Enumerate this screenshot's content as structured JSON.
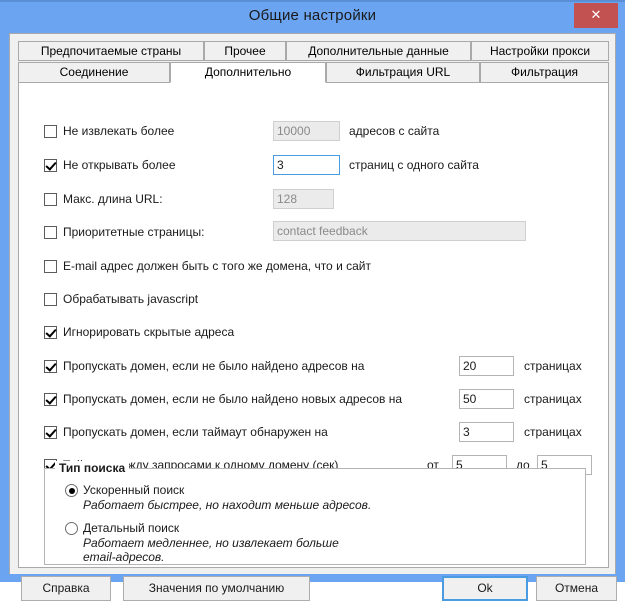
{
  "window": {
    "title": "Общие настройки",
    "close_label": "✕",
    "titlebar_color": "#6ba5f2",
    "close_color": "#c25252"
  },
  "tabs": {
    "row1": [
      {
        "label": "Предпочитаемые страны",
        "active": false
      },
      {
        "label": "Прочее",
        "active": false
      },
      {
        "label": "Дополнительные данные",
        "active": false
      },
      {
        "label": "Настройки прокси",
        "active": false
      }
    ],
    "row2": [
      {
        "label": "Соединение",
        "active": false
      },
      {
        "label": "Дополнительно",
        "active": true
      },
      {
        "label": "Фильтрация URL",
        "active": false
      },
      {
        "label": "Фильтрация",
        "active": false
      }
    ]
  },
  "options": {
    "max_extract": {
      "label": "Не извлекать более",
      "checked": false,
      "value": "10000",
      "suffix": "адресов с сайта",
      "disabled": true
    },
    "max_open": {
      "label": "Не открывать более",
      "checked": true,
      "value": "3",
      "suffix": "страниц с одного сайта",
      "disabled": false,
      "focused": true
    },
    "max_url_len": {
      "label": "Макс. длина URL:",
      "checked": false,
      "value": "128",
      "suffix": "",
      "disabled": true
    },
    "priority_pages": {
      "label": "Приоритетные страницы:",
      "checked": false,
      "value": "contact feedback",
      "suffix": "",
      "disabled": true
    },
    "same_domain_email": {
      "label": "E-mail адрес должен быть с того же домена, что и сайт",
      "checked": false
    },
    "process_javascript": {
      "label": "Обрабатывать javascript",
      "checked": false
    },
    "ignore_hidden": {
      "label": "Игнорировать скрытые адреса",
      "checked": true
    },
    "skip_no_addresses": {
      "label": "Пропускать домен, если не было найдено адресов на",
      "checked": true,
      "value": "20",
      "suffix": "страницах"
    },
    "skip_no_new_addresses": {
      "label": "Пропускать домен, если не было найдено новых адресов на",
      "checked": true,
      "value": "50",
      "suffix": "страницах"
    },
    "skip_timeout": {
      "label": "Пропускать домен, если таймаут обнаружен на",
      "checked": true,
      "value": "3",
      "suffix": "страницах"
    },
    "request_timeout": {
      "label": "Таймаут между запросами к одному домену (сек)",
      "checked": true,
      "from_label": "от",
      "from_value": "5",
      "to_label": "до",
      "to_value": "5"
    }
  },
  "search_type": {
    "title": "Тип поиска",
    "options": [
      {
        "label": "Ускоренный поиск",
        "description": "Работает быстрее, но находит меньше адресов.",
        "selected": true
      },
      {
        "label": "Детальный поиск",
        "description": "Работает медленнее, но извлекает больше\nemail-адресов.",
        "selected": false
      }
    ]
  },
  "buttons": {
    "help": "Справка",
    "defaults": "Значения по умолчанию",
    "ok": "Ok",
    "cancel": "Отмена"
  }
}
